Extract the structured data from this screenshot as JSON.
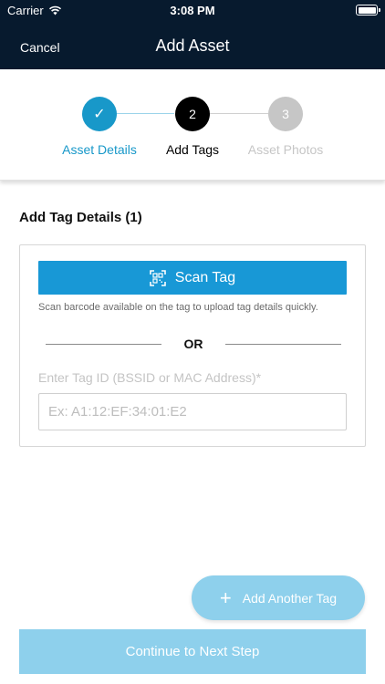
{
  "status_bar": {
    "carrier": "Carrier",
    "time": "3:08 PM"
  },
  "header": {
    "cancel_label": "Cancel",
    "title": "Add Asset"
  },
  "stepper": {
    "steps": [
      {
        "number": "✓",
        "label": "Asset Details",
        "state": "completed"
      },
      {
        "number": "2",
        "label": "Add Tags",
        "state": "active"
      },
      {
        "number": "3",
        "label": "Asset Photos",
        "state": "pending"
      }
    ]
  },
  "main": {
    "section_title": "Add Tag Details (1)",
    "scan_button_label": "Scan Tag",
    "scan_help": "Scan barcode available on the tag to upload tag details quickly.",
    "or_label": "OR",
    "field_label": "Enter Tag ID (BSSID or MAC Address)*",
    "field_value": "",
    "field_placeholder": "Ex: A1:12:EF:34:01:E2"
  },
  "footer": {
    "add_another_label": "Add Another Tag",
    "continue_label": "Continue to Next Step"
  },
  "icons": {
    "wifi": "wifi-icon",
    "battery": "battery-icon",
    "check": "check-icon",
    "qr": "qr-scan-icon",
    "plus": "plus-icon"
  },
  "colors": {
    "header_bg": "#071a2e",
    "accent": "#1898c9",
    "scan_button": "#1898d6",
    "disabled_button": "#8ed0ec",
    "inactive_step": "#c6c6c6"
  }
}
